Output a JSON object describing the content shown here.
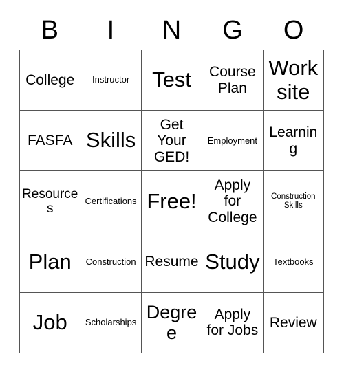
{
  "card": {
    "title": "BINGO Card",
    "columns": 5,
    "rows": 5,
    "border_color": "#555555",
    "text_color": "#000000",
    "background_color": "#ffffff"
  },
  "header": {
    "letters": [
      "B",
      "I",
      "N",
      "G",
      "O"
    ]
  },
  "grid": {
    "rows": [
      {
        "cells": [
          {
            "text": "College",
            "size": "md"
          },
          {
            "text": "Instructor",
            "size": "xs"
          },
          {
            "text": "Test",
            "size": "xl"
          },
          {
            "text": "Course Plan",
            "size": "md"
          },
          {
            "text": "Work site",
            "size": "xl"
          }
        ]
      },
      {
        "cells": [
          {
            "text": "FASFA",
            "size": "md"
          },
          {
            "text": "Skills",
            "size": "xl"
          },
          {
            "text": "Get Your GED!",
            "size": "md"
          },
          {
            "text": "Employment",
            "size": "xs"
          },
          {
            "text": "Learning",
            "size": "md"
          }
        ]
      },
      {
        "cells": [
          {
            "text": "Resources",
            "size": "sm"
          },
          {
            "text": "Certifications",
            "size": "xs"
          },
          {
            "text": "Free!",
            "size": "xl"
          },
          {
            "text": "Apply for College",
            "size": "md"
          },
          {
            "text": "Construction Skills",
            "size": "xxs"
          }
        ]
      },
      {
        "cells": [
          {
            "text": "Plan",
            "size": "xl"
          },
          {
            "text": "Construction",
            "size": "xs"
          },
          {
            "text": "Resume",
            "size": "md"
          },
          {
            "text": "Study",
            "size": "xl"
          },
          {
            "text": "Textbooks",
            "size": "xs"
          }
        ]
      },
      {
        "cells": [
          {
            "text": "Job",
            "size": "xl"
          },
          {
            "text": "Scholarships",
            "size": "xs"
          },
          {
            "text": "Degree",
            "size": "lg"
          },
          {
            "text": "Apply for Jobs",
            "size": "md"
          },
          {
            "text": "Review",
            "size": "md"
          }
        ]
      }
    ]
  }
}
